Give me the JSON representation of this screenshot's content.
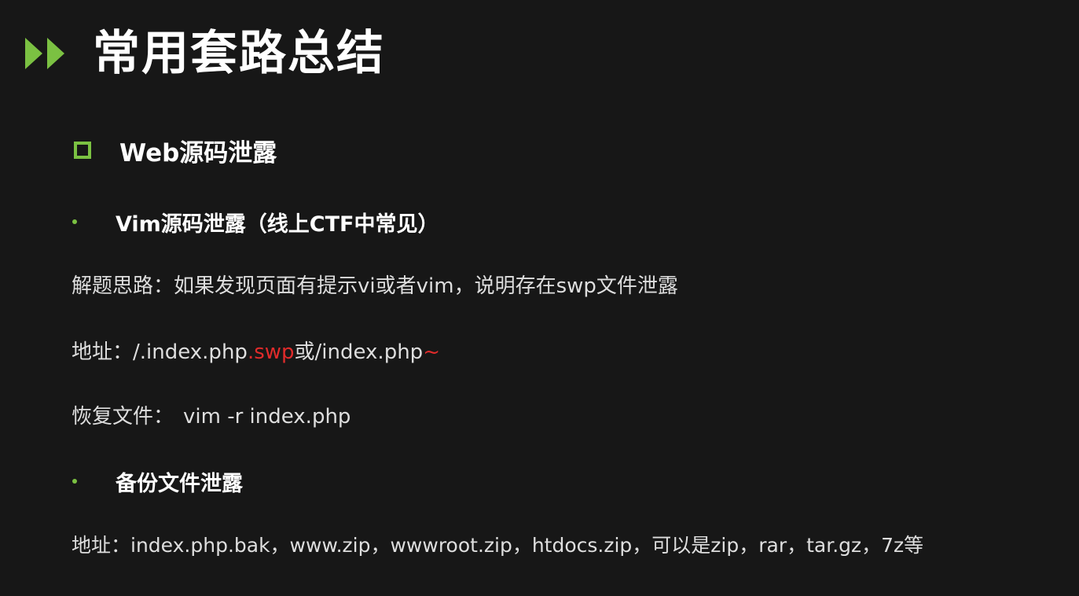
{
  "title": "常用套路总结",
  "section": {
    "label": "Web源码泄露"
  },
  "vim": {
    "heading": "Vim源码泄露（线上CTF中常见）",
    "idea_label": "解题思路：",
    "idea_text": "如果发现页面有提示vi或者vim，说明存在swp文件泄露",
    "addr_label": "地址：",
    "addr_part1": "/.index.php",
    "addr_part2": ".swp",
    "addr_part3": "或/index.php",
    "addr_part4": "~",
    "recover_label": "恢复文件：",
    "recover_cmd": "vim -r index.php"
  },
  "backup": {
    "heading": "备份文件泄露",
    "addr_label": "地址：",
    "addr_text": "index.php.bak，www.zip，wwwroot.zip，htdocs.zip，可以是zip，rar，tar.gz，7z等"
  },
  "colors": {
    "accent": "#7bc142",
    "highlight": "#e02b2b",
    "background": "#171717"
  },
  "icons": {
    "title": "double-arrow-icon",
    "section": "square-bullet-icon",
    "bullet": "dot-bullet-icon"
  }
}
